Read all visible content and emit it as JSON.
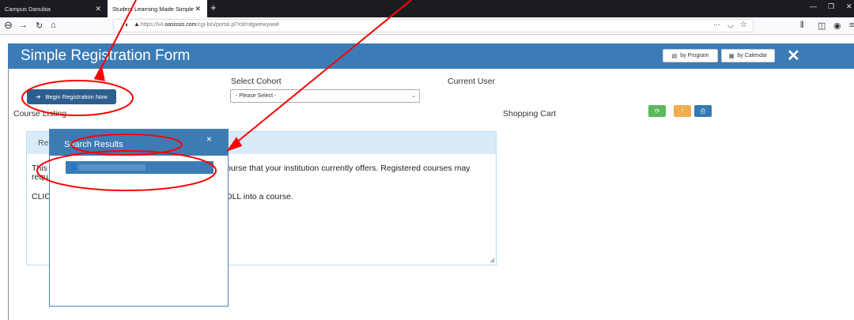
{
  "browser": {
    "tabs": [
      {
        "label": "Campus Danubia"
      },
      {
        "label": "Student Learning Made Simple"
      }
    ],
    "url_prefix": "https://v4.",
    "url_domain": "oasissis.com",
    "url_path": "/cgi-bin/portal.pl?cid=dgwewyaw#"
  },
  "header": {
    "title": "Simple Registration Form",
    "by_program": "by Program",
    "by_calendar": "by Calendar"
  },
  "form": {
    "begin_button": "Begin Registration Now",
    "select_cohort_label": "Select Cohort",
    "cohort_value": "- Please Select -",
    "current_user_label": "Current User",
    "course_listing_label": "Course Listing",
    "shopping_cart_label": "Shopping Cart"
  },
  "panel": {
    "tab_label": "Re",
    "line1_left": "This",
    "line1_right": "ourse that your institution currently offers. Registered courses may",
    "line2_left": "requ",
    "line3_left": "CLIC",
    "line3_right": "DLL into a course."
  },
  "modal": {
    "title": "Search Results",
    "close": "×"
  },
  "colors": {
    "brand": "#3c7cb6",
    "begin_button": "#2c5f8f",
    "cart_green": "#5cb85c",
    "cart_orange": "#f0ad4e",
    "cart_blue": "#337ab7",
    "annotation": "#ff0000"
  },
  "icons": {
    "begin": "arrow-right-icon",
    "program": "document-icon",
    "calendar": "calendar-icon",
    "close": "close-icon",
    "refresh": "refresh-icon",
    "alert": "exclamation-icon",
    "print": "print-icon",
    "user": "user-icon"
  }
}
